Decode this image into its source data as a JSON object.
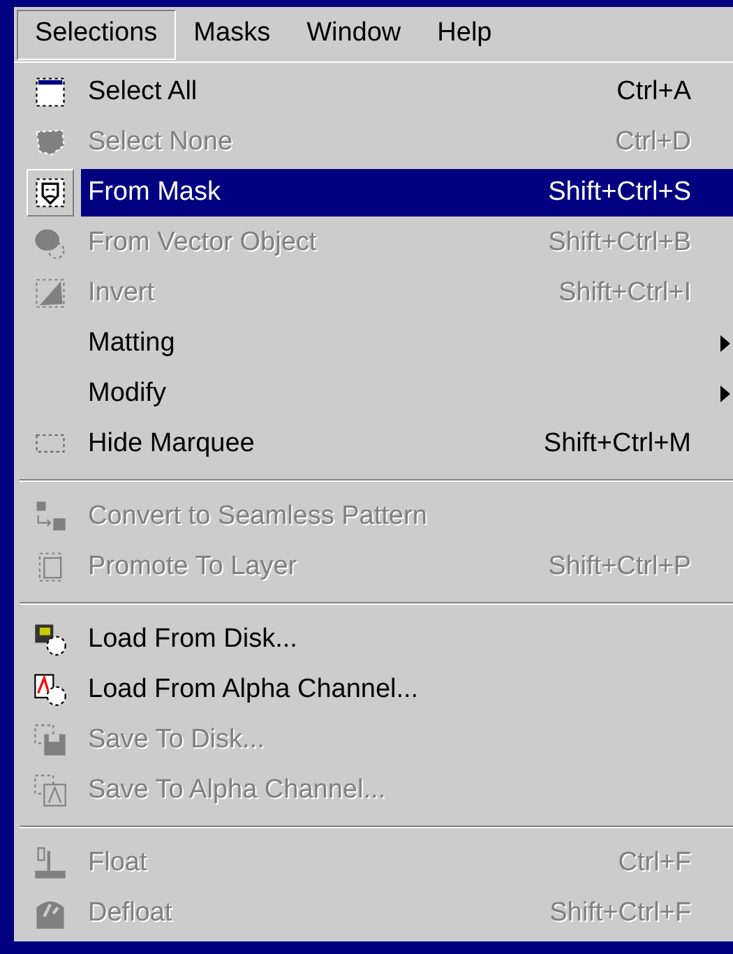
{
  "menu_bar": [
    {
      "label": "Selections",
      "selected": true
    },
    {
      "label": "Masks",
      "selected": false
    },
    {
      "label": "Window",
      "selected": false
    },
    {
      "label": "Help",
      "selected": false
    }
  ],
  "menu": [
    {
      "kind": "command",
      "label": "Select All",
      "shortcut": "Ctrl+A",
      "disabled": false,
      "selected": false
    },
    {
      "kind": "command",
      "label": "Select None",
      "shortcut": "Ctrl+D",
      "disabled": true,
      "selected": false
    },
    {
      "kind": "command",
      "label": "From Mask",
      "shortcut": "Shift+Ctrl+S",
      "disabled": false,
      "selected": true
    },
    {
      "kind": "command",
      "label": "From Vector Object",
      "shortcut": "Shift+Ctrl+B",
      "disabled": true,
      "selected": false
    },
    {
      "kind": "command",
      "label": "Invert",
      "shortcut": "Shift+Ctrl+I",
      "disabled": true,
      "selected": false
    },
    {
      "kind": "submenu",
      "label": "Matting",
      "disabled": false,
      "selected": false
    },
    {
      "kind": "submenu",
      "label": "Modify",
      "disabled": false,
      "selected": false
    },
    {
      "kind": "command",
      "label": "Hide Marquee",
      "shortcut": "Shift+Ctrl+M",
      "disabled": false,
      "selected": false
    },
    {
      "kind": "separator"
    },
    {
      "kind": "command",
      "label": "Convert to Seamless Pattern",
      "disabled": true,
      "selected": false
    },
    {
      "kind": "command",
      "label": "Promote To Layer",
      "shortcut": "Shift+Ctrl+P",
      "disabled": true,
      "selected": false
    },
    {
      "kind": "separator"
    },
    {
      "kind": "command",
      "label": "Load From Disk...",
      "disabled": false,
      "selected": false
    },
    {
      "kind": "command",
      "label": "Load From Alpha Channel...",
      "disabled": false,
      "selected": false
    },
    {
      "kind": "command",
      "label": "Save To Disk...",
      "disabled": true,
      "selected": false
    },
    {
      "kind": "command",
      "label": "Save To Alpha Channel...",
      "disabled": true,
      "selected": false
    },
    {
      "kind": "separator"
    },
    {
      "kind": "command",
      "label": "Float",
      "shortcut": "Ctrl+F",
      "disabled": true,
      "selected": false
    },
    {
      "kind": "command",
      "label": "Defloat",
      "shortcut": "Shift+Ctrl+F",
      "disabled": true,
      "selected": false
    }
  ]
}
